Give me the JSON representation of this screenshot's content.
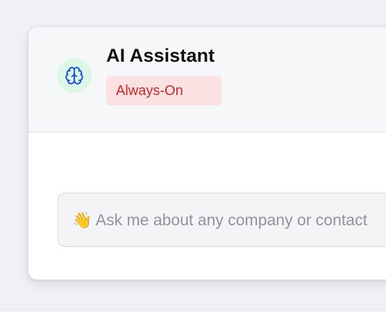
{
  "assistant": {
    "title": "AI Assistant",
    "status_badge": "Always-On",
    "icon": "brain-icon"
  },
  "chat": {
    "placeholder": "👋 Ask me about any company or contact",
    "value": ""
  },
  "colors": {
    "page_background": "#f0f1f4",
    "header_background": "#f6f7f9",
    "avatar_background": "#dcf7e6",
    "brain_icon": "#1d4ed8",
    "badge_background": "#fbe1e1",
    "badge_text": "#c62828"
  }
}
